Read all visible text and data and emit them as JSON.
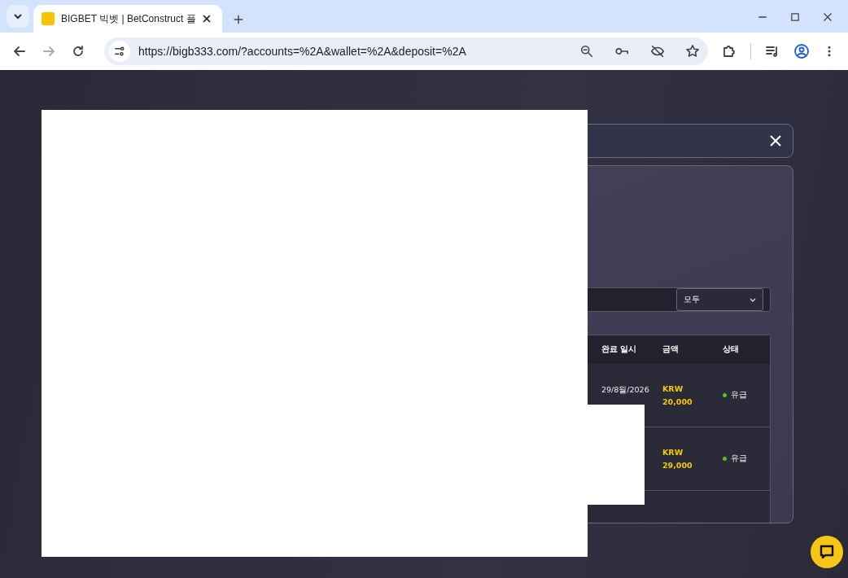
{
  "browser": {
    "tab_title": "BIGBET 빅벳 | BetConstruct 플",
    "url": "https://bigb333.com/?accounts=%2A&wallet=%2A&deposit=%2A"
  },
  "modal": {
    "filter": {
      "value": "모두"
    },
    "table": {
      "columns": [
        "완료 일시",
        "금액",
        "상태"
      ],
      "rows": [
        {
          "completed": "29/8월/2026",
          "currency": "KRW",
          "amount": "20,000",
          "status": "유급"
        },
        {
          "completed": "",
          "currency": "KRW",
          "amount": "29,000",
          "status": "유급"
        }
      ]
    }
  }
}
